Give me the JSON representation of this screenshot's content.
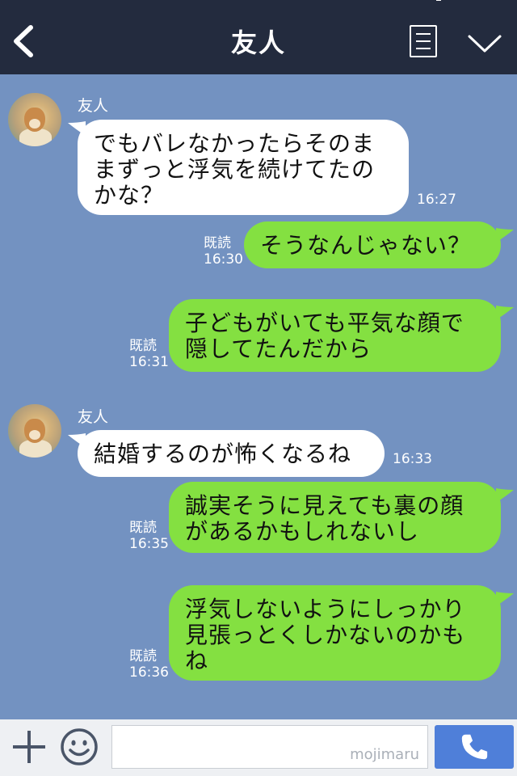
{
  "header": {
    "title": "友人"
  },
  "messages": [
    {
      "type": "in",
      "sender": "友人",
      "text_lines": [
        "でもバレなかったらそのま",
        "まずっと浮気を続けてたの",
        "かな？"
      ],
      "time": "16:27"
    },
    {
      "type": "out",
      "read": "既読",
      "time": "16:30",
      "text_lines": [
        "そうなんじゃない？"
      ]
    },
    {
      "type": "out",
      "read": "既読",
      "time": "16:31",
      "text_lines": [
        "子どもがいても平気な顔で",
        "隠してたんだから"
      ]
    },
    {
      "type": "in",
      "sender": "友人",
      "text_lines": [
        "結婚するのが怖くなるね"
      ],
      "time": "16:33"
    },
    {
      "type": "out",
      "read": "既読",
      "time": "16:35",
      "text_lines": [
        "誠実そうに見えても裏の顔",
        "があるかもしれないし"
      ]
    },
    {
      "type": "out",
      "read": "既読",
      "time": "16:36",
      "text_lines": [
        "浮気しないようにしっかり",
        "見張っとくしかないのかも",
        "ね"
      ]
    }
  ],
  "footer": {
    "input_value": "",
    "watermark": "mojimaru"
  },
  "icons": {
    "back": "chevron-left-icon",
    "menu": "list-icon",
    "collapse": "chevron-down-icon",
    "add": "plus-icon",
    "sticker": "smile-icon",
    "call": "phone-icon"
  },
  "colors": {
    "header": "#232b3e",
    "background": "#7392c1",
    "out_bubble": "#84e041",
    "in_bubble": "#ffffff",
    "call_button": "#4f7fd9"
  }
}
